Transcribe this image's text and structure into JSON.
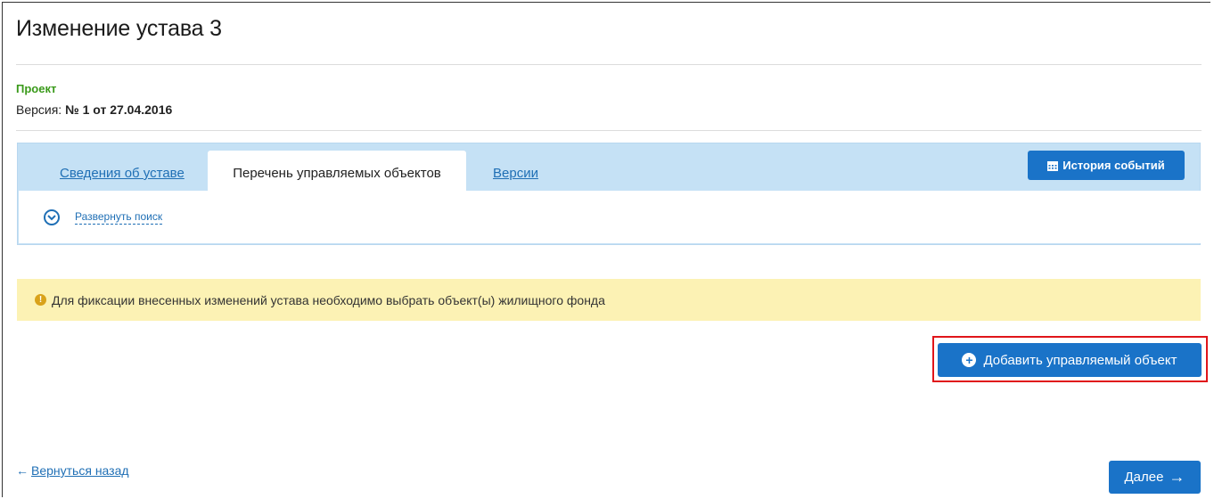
{
  "page": {
    "title": "Изменение устава 3",
    "status": "Проект",
    "version_label": "Версия:",
    "version_value": "№ 1 от 27.04.2016"
  },
  "tabs": [
    {
      "label": "Сведения об уставе",
      "active": false
    },
    {
      "label": "Перечень управляемых объектов",
      "active": true
    },
    {
      "label": "Версии",
      "active": false
    }
  ],
  "history_button": {
    "label": "История событий",
    "icon": "calendar-icon"
  },
  "search": {
    "expand_label": "Развернуть поиск",
    "icon": "chevron-down-circle-icon"
  },
  "alert": {
    "icon": "exclamation-circle-icon",
    "text": "Для фиксации внесенных изменений устава необходимо выбрать объект(ы) жилищного фонда"
  },
  "add_button": {
    "label": "Добавить управляемый объект",
    "icon": "plus-circle-icon"
  },
  "footer": {
    "back_label": "Вернуться назад",
    "next_label": "Далее"
  },
  "colors": {
    "primary": "#1a73c8",
    "link": "#1f6fb5",
    "status_green": "#3a9a1a",
    "tab_bg": "#c5e1f5",
    "alert_bg": "#fcf2b4",
    "highlight_red": "#e0151a"
  }
}
